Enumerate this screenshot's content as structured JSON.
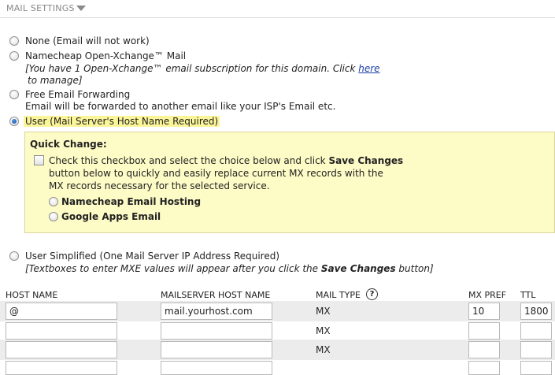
{
  "header": {
    "title": "MAIL SETTINGS"
  },
  "options": [
    {
      "id": "none",
      "label": "None (Email will not work)",
      "checked": false
    },
    {
      "id": "oxchange",
      "label": "Namecheap Open-Xchange™ Mail",
      "checked": false,
      "note_pre": "[You have 1 Open-Xchange™ email subscription for this domain. Click ",
      "note_link": "here",
      "note_post": "to manage]"
    },
    {
      "id": "forward",
      "label": "Free Email Forwarding",
      "checked": false,
      "desc": "Email will be forwarded to another email like your ISP's Email etc."
    },
    {
      "id": "user",
      "label": "User (Mail Server's Host Name Required)",
      "checked": true
    },
    {
      "id": "simplified",
      "label": "User Simplified (One Mail Server IP Address Required)",
      "checked": false,
      "note_pre": "[Textboxes to enter MXE values will appear after you click the ",
      "note_bold": "Save Changes",
      "note_post": " button]"
    }
  ],
  "quick_change": {
    "title": "Quick Change:",
    "line1_pre": "Check this checkbox and select the choice below and click ",
    "line1_bold": "Save Changes",
    "line2": "button below to quickly and easily replace current MX records with the",
    "line3": "MX records necessary for the selected service.",
    "choices": [
      "Namecheap Email Hosting",
      "Google Apps Email"
    ]
  },
  "table": {
    "columns": {
      "host": "HOST NAME",
      "mailserver": "MAILSERVER HOST NAME",
      "mailtype": "MAIL TYPE",
      "help": "?",
      "mxpref": "MX PREF",
      "ttl": "TTL"
    },
    "rows": [
      {
        "host": "@",
        "mailserver": "mail.yourhost.com",
        "type": "MX",
        "pref": "10",
        "ttl": "1800"
      },
      {
        "host": "",
        "mailserver": "",
        "type": "MX",
        "pref": "",
        "ttl": ""
      },
      {
        "host": "",
        "mailserver": "",
        "type": "MX",
        "pref": "",
        "ttl": ""
      },
      {
        "host": "",
        "mailserver": "",
        "type": "",
        "pref": "",
        "ttl": ""
      }
    ]
  }
}
